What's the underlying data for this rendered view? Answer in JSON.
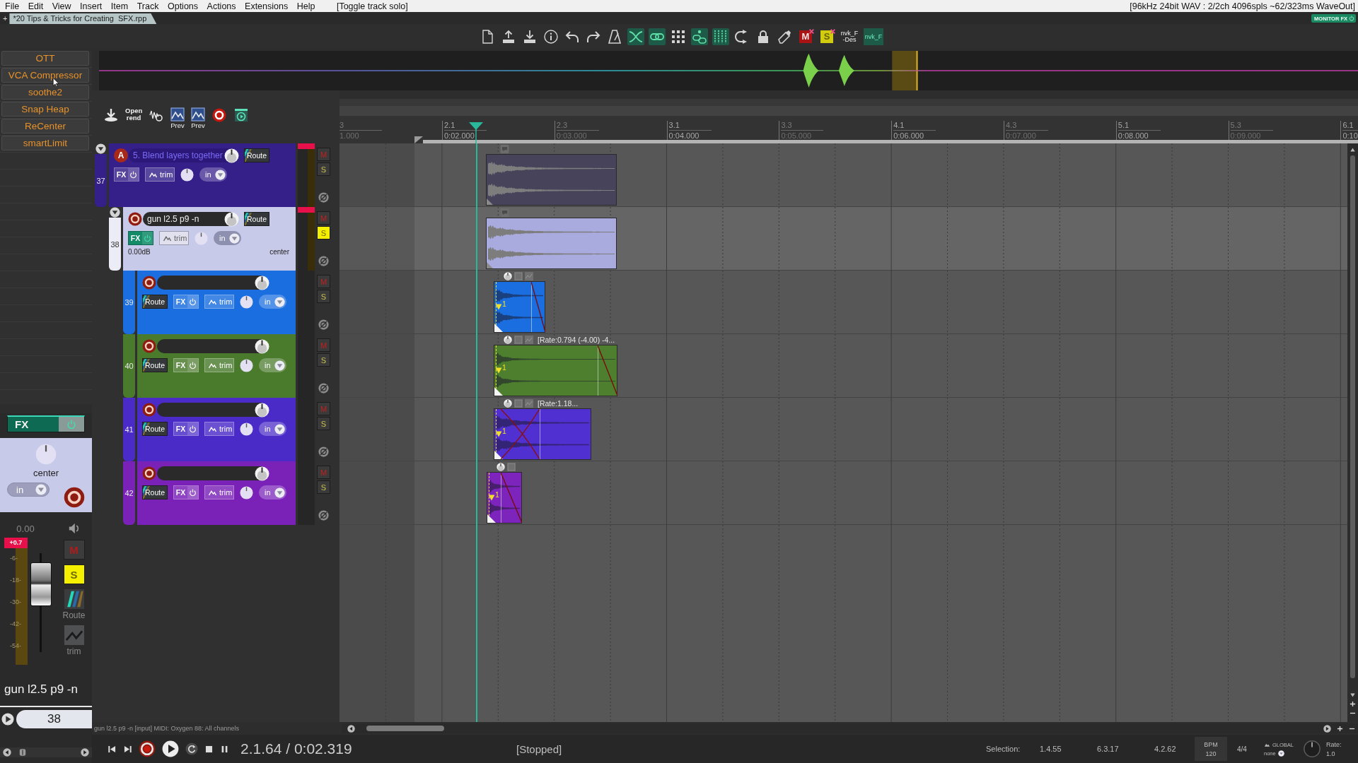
{
  "menu_bar": {
    "items": [
      "File",
      "Edit",
      "View",
      "Insert",
      "Item",
      "Track",
      "Options",
      "Actions",
      "Extensions",
      "Help"
    ],
    "action_hint": "[Toggle track solo]",
    "audio_status": "[96kHz 24bit WAV : 2/2ch 4096spls ~62/323ms WaveOut]"
  },
  "project_tabs": {
    "add": "+",
    "tabs": [
      {
        "label": "*20 Tips & Tricks for Creating  SFX.rpp",
        "selected": true
      }
    ],
    "monitor_fx": "MONITOR FX"
  },
  "toolbar": [
    {
      "kind": "icon",
      "on": false
    },
    {
      "kind": "icon",
      "on": false
    },
    {
      "kind": "icon",
      "on": false
    },
    {
      "kind": "icon",
      "on": false
    },
    {
      "kind": "icon",
      "on": false
    },
    {
      "kind": "icon",
      "on": false
    },
    {
      "kind": "icon",
      "on": false
    },
    {
      "kind": "icon",
      "on": true
    },
    {
      "kind": "icon",
      "on": true
    },
    {
      "kind": "icon",
      "on": false
    },
    {
      "kind": "icon",
      "on": true
    },
    {
      "kind": "icon",
      "on": true
    },
    {
      "kind": "icon",
      "on": false
    },
    {
      "kind": "icon",
      "on": false
    },
    {
      "kind": "icon",
      "on": false
    },
    {
      "kind": "letter",
      "label": "M",
      "color": "#a81414"
    },
    {
      "kind": "letter",
      "label": "S",
      "color": "#d2cc10"
    },
    {
      "kind": "text",
      "label": "nvk_F -Des",
      "on": false
    },
    {
      "kind": "text",
      "label": "nvk_F",
      "on": true
    }
  ],
  "fx_buttons": [
    {
      "label": "OTT"
    },
    {
      "label": "VCA Compressor"
    },
    {
      "label": "soothe2"
    },
    {
      "label": "Snap Heap"
    },
    {
      "label": "ReCenter"
    },
    {
      "label": "smartLimit"
    }
  ],
  "track_toolbar": [
    {
      "kind": "icon"
    },
    {
      "kind": "text",
      "label": "Open rend"
    },
    {
      "kind": "icon"
    },
    {
      "kind": "captioned",
      "label": "Prev"
    },
    {
      "kind": "captioned",
      "label": "Prev"
    },
    {
      "kind": "icon"
    },
    {
      "kind": "icon"
    }
  ],
  "ruler": {
    "marks": [
      {
        "bar": "3",
        "time": "1.000",
        "major": false
      },
      {
        "bar": "2.1",
        "time": "0:02.000",
        "major": true
      },
      {
        "bar": "2.3",
        "time": "0:03.000",
        "major": false
      },
      {
        "bar": "3.1",
        "time": "0:04.000",
        "major": true
      },
      {
        "bar": "3.3",
        "time": "0:05.000",
        "major": false
      },
      {
        "bar": "4.1",
        "time": "0:06.000",
        "major": true
      },
      {
        "bar": "4.3",
        "time": "0:07.000",
        "major": false
      },
      {
        "bar": "5.1",
        "time": "0:08.000",
        "major": true
      },
      {
        "bar": "5.3",
        "time": "0:09.000",
        "major": false
      },
      {
        "bar": "6.1",
        "time": "0:10",
        "major": true
      }
    ]
  },
  "tracks": [
    {
      "number": "37",
      "name": "5. Blend layers together",
      "name_dimmed": true,
      "color": "#35208a",
      "selected": false,
      "expanded": true,
      "arm": {
        "kind": "letter",
        "label": "A"
      },
      "route": "Route",
      "fx": {
        "label": "FX",
        "on": false
      },
      "trim": "trim",
      "input": "in",
      "mute": {
        "label": "M",
        "on": false
      },
      "solo": {
        "label": "S",
        "on": false
      },
      "clip": true,
      "item": {
        "color": "#46435a"
      },
      "children": [
        {
          "number": "38",
          "name": "gun l2.5 p9 -n",
          "name_dimmed": false,
          "selected": true,
          "expanded": true,
          "arm": {
            "kind": "record"
          },
          "route": "Route",
          "fx": {
            "label": "FX",
            "on": true
          },
          "trim": "trim",
          "input": "in",
          "volume": "0.00dB",
          "pan": "center",
          "mute": {
            "label": "M",
            "on": false
          },
          "solo": {
            "label": "S",
            "on": true
          },
          "clip": true,
          "item": {
            "color": "#a9abdf"
          },
          "children": [
            {
              "number": "39",
              "name_dimmed": false,
              "color": "#1a6ee0",
              "selected": false,
              "arm": {
                "kind": "record"
              },
              "route": "Route",
              "fx": {
                "label": "FX",
                "on": false
              },
              "trim": "trim",
              "input": "in",
              "mute": {
                "label": "M",
                "on": false
              },
              "solo": {
                "label": "S",
                "on": false
              },
              "clip": false,
              "item": {
                "color": "#1a6ee0",
                "take": "1"
              }
            },
            {
              "number": "40",
              "name_dimmed": false,
              "color": "#4a7a2c",
              "selected": false,
              "arm": {
                "kind": "record"
              },
              "route": "Route",
              "fx": {
                "label": "FX",
                "on": false
              },
              "trim": "trim",
              "input": "in",
              "mute": {
                "label": "M",
                "on": false
              },
              "solo": {
                "label": "S",
                "on": false
              },
              "clip": false,
              "item": {
                "color": "#4e7f2e",
                "take": "1",
                "label": "[Rate:0.794 (-4.00) -4..."
              }
            },
            {
              "number": "41",
              "name_dimmed": false,
              "color": "#4b2bc8",
              "selected": false,
              "arm": {
                "kind": "record"
              },
              "route": "Route",
              "fx": {
                "label": "FX",
                "on": false
              },
              "trim": "trim",
              "input": "in",
              "mute": {
                "label": "M",
                "on": false
              },
              "solo": {
                "label": "S",
                "on": false
              },
              "clip": false,
              "item": {
                "color": "#5030d0",
                "take": "1",
                "label": "[Rate:1.18..."
              }
            },
            {
              "number": "42",
              "name_dimmed": false,
              "color": "#7a22b8",
              "selected": false,
              "arm": {
                "kind": "record"
              },
              "route": "Route",
              "fx": {
                "label": "FX",
                "on": false
              },
              "trim": "trim",
              "input": "in",
              "mute": {
                "label": "M",
                "on": false
              },
              "solo": {
                "label": "S",
                "on": false
              },
              "clip": false,
              "item": {
                "color": "#7d24bc",
                "take": "1"
              }
            }
          ]
        }
      ]
    }
  ],
  "mixer_strip": {
    "fx": {
      "label": "FX",
      "on": true
    },
    "pan": "center",
    "input": "in",
    "volume": "0.00",
    "peak": "+0.7",
    "scale": [
      "-6-",
      "-18-",
      "-30-",
      "-42-",
      "-54-"
    ],
    "level": 0.83,
    "mute": {
      "label": "M",
      "on": false
    },
    "solo": {
      "label": "S",
      "on": true
    },
    "route": "Route",
    "trim": "trim",
    "name": "gun l2.5 p9 -n",
    "number": "38"
  },
  "status_line": "gun l2.5 p9 -n [input] MIDI: Oxygen 88: All channels",
  "transport": {
    "time": "2.1.64 / 0:02.319",
    "state": "[Stopped]",
    "selection_label": "Selection:",
    "selection": [
      "1.4.55",
      "6.3.17",
      "4.2.62"
    ],
    "bpm_label": "BPM",
    "bpm": "120",
    "time_signature": "4/4",
    "global_label": "GLOBAL",
    "global_value": "none",
    "rate_label": "Rate:",
    "rate": "1.0"
  }
}
